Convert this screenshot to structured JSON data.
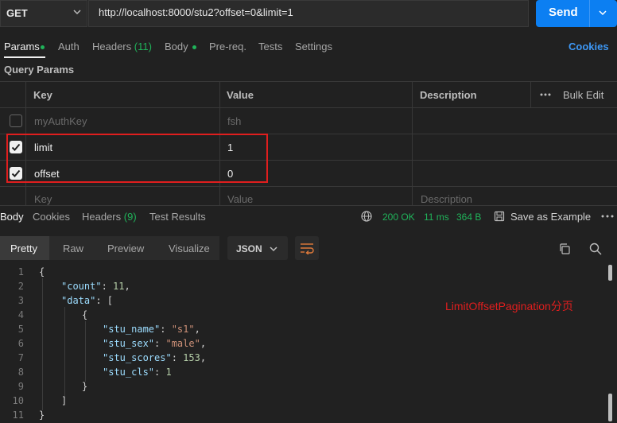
{
  "request": {
    "method": "GET",
    "url": "http://localhost:8000/stu2?offset=0&limit=1",
    "send_label": "Send"
  },
  "request_tabs": {
    "params": "Params",
    "auth": "Auth",
    "headers": "Headers",
    "headers_count": "(11)",
    "body": "Body",
    "prereq": "Pre-req.",
    "tests": "Tests",
    "settings": "Settings",
    "cookies": "Cookies"
  },
  "query_params": {
    "title": "Query Params",
    "headers": {
      "key": "Key",
      "value": "Value",
      "description": "Description",
      "bulk_edit": "Bulk Edit"
    },
    "rows": [
      {
        "checked": false,
        "key": "myAuthKey",
        "value": "fsh",
        "description": ""
      },
      {
        "checked": true,
        "key": "limit",
        "value": "1",
        "description": ""
      },
      {
        "checked": true,
        "key": "offset",
        "value": "0",
        "description": ""
      }
    ],
    "placeholder": {
      "key": "Key",
      "value": "Value",
      "description": "Description"
    }
  },
  "response_tabs": {
    "body": "Body",
    "cookies": "Cookies",
    "headers": "Headers",
    "headers_count": "(9)",
    "test_results": "Test Results",
    "status": "200 OK",
    "time": "11 ms",
    "size": "364 B",
    "save_example": "Save as Example"
  },
  "response_toolbar": {
    "pretty": "Pretty",
    "raw": "Raw",
    "preview": "Preview",
    "visualize": "Visualize",
    "format": "JSON"
  },
  "code_lines": {
    "l1": "1",
    "l2": "2",
    "l3": "3",
    "l4": "4",
    "l5": "5",
    "l6": "6",
    "l7": "7",
    "l8": "8",
    "l9": "9",
    "l10": "10",
    "l11": "11"
  },
  "json_body": {
    "count_key": "\"count\"",
    "count_val": "11",
    "data_key": "\"data\"",
    "stu_name_key": "\"stu_name\"",
    "stu_name_val": "\"s1\"",
    "stu_sex_key": "\"stu_sex\"",
    "stu_sex_val": "\"male\"",
    "stu_scores_key": "\"stu_scores\"",
    "stu_scores_val": "153",
    "stu_cls_key": "\"stu_cls\"",
    "stu_cls_val": "1"
  },
  "annotation": "LimitOffsetPagination分页",
  "colors": {
    "accent": "#0c7ff2",
    "success": "#20b35a",
    "annotation": "#e01e1e",
    "background": "#212121"
  },
  "icons": [
    "chevron-down-icon",
    "globe-icon",
    "save-icon",
    "more-icon",
    "wrap-lines-icon",
    "copy-icon",
    "search-icon"
  ]
}
